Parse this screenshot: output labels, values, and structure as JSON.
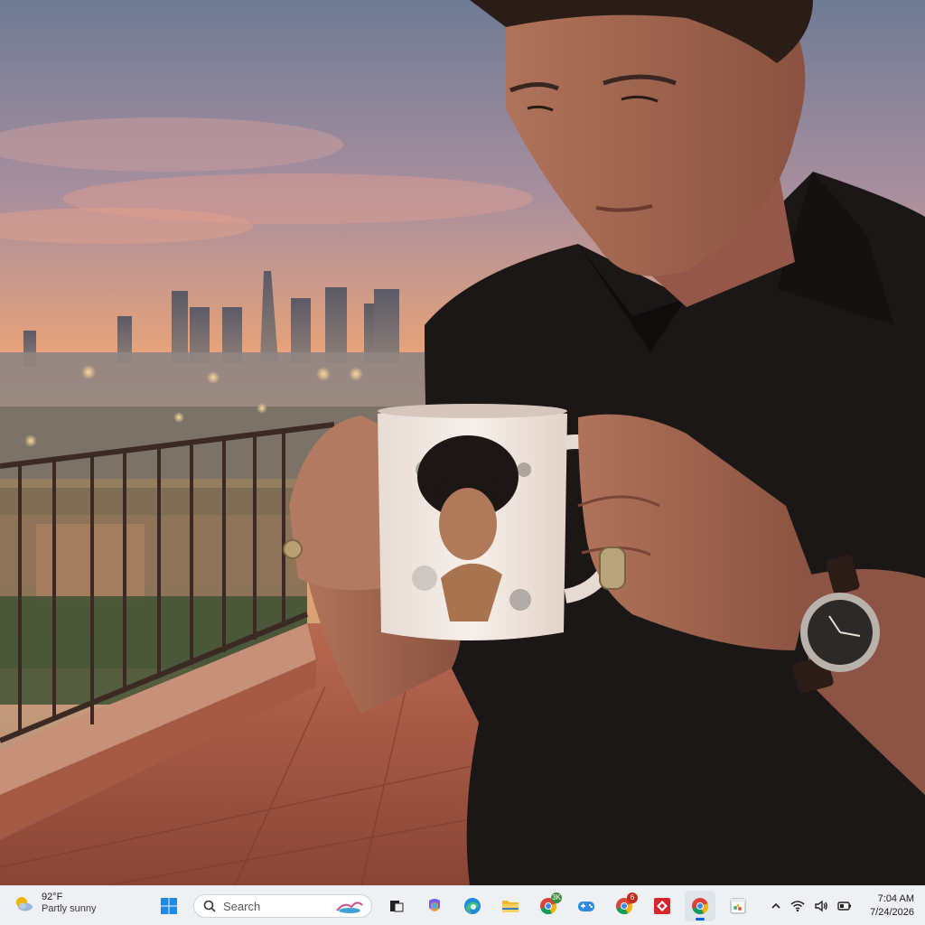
{
  "wallpaper": {
    "description_icon": "photo-wallpaper",
    "colors": {
      "sky_top": "#6f7b95",
      "sunset": "#f3a35e",
      "shirt": "#1b1716",
      "mug": "#f1e9e3"
    }
  },
  "taskbar": {
    "weather": {
      "temperature": "92°F",
      "condition": "Partly sunny",
      "icon": "sun-cloud-icon"
    },
    "search": {
      "placeholder": "Search"
    },
    "apps": [
      {
        "name": "start-button",
        "icon": "windows-logo-icon"
      },
      {
        "name": "task-view",
        "icon": "task-view-icon"
      },
      {
        "name": "copilot",
        "icon": "copilot-icon"
      },
      {
        "name": "edge",
        "icon": "edge-icon"
      },
      {
        "name": "file-explorer",
        "icon": "folder-icon"
      },
      {
        "name": "chrome-profile-1",
        "icon": "chrome-icon",
        "badge": "3K"
      },
      {
        "name": "game-app",
        "icon": "gamepad-icon"
      },
      {
        "name": "chrome-profile-2",
        "icon": "chrome-icon",
        "badge": "6"
      },
      {
        "name": "red-app",
        "icon": "red-diamond-icon"
      },
      {
        "name": "chrome-active",
        "icon": "chrome-icon"
      },
      {
        "name": "timing-app",
        "icon": "calendar-icon"
      }
    ],
    "tray": {
      "icons": [
        "chevron-up-icon",
        "wifi-icon",
        "volume-icon",
        "battery-icon"
      ],
      "time": "7:04 AM",
      "date": "7/24/2026"
    }
  }
}
